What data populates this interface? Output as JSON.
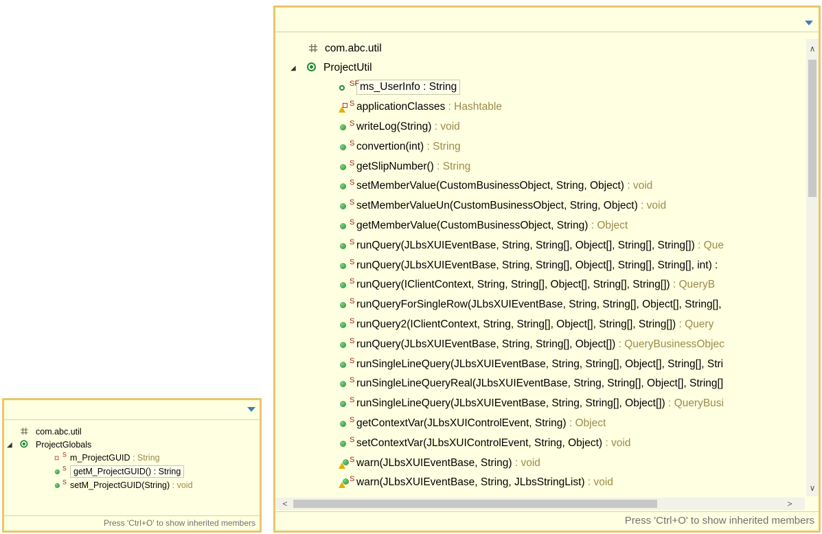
{
  "left_popup": {
    "search_value": "",
    "footer": "Press 'Ctrl+O' to show inherited members",
    "package": "com.abc.util",
    "class_name": "ProjectGlobals",
    "members": [
      {
        "name": "m_ProjectGUID",
        "ret": " : String",
        "modifier": "S",
        "icon": "private-field-icon",
        "ret_muted": true
      },
      {
        "name": "getM_ProjectGUID() : String",
        "ret": "",
        "modifier": "S",
        "icon": "public-method-icon",
        "ret_muted": false,
        "selected": true
      },
      {
        "name": "setM_ProjectGUID(String)",
        "ret": " : void",
        "modifier": "S",
        "icon": "public-method-icon",
        "ret_muted": true
      }
    ]
  },
  "right_popup": {
    "search_value": "",
    "footer": "Press 'Ctrl+O' to show inherited members",
    "package": "com.abc.util",
    "class_name": "ProjectUtil",
    "members": [
      {
        "name": "ms_UserInfo : String",
        "ret": "",
        "modifier": "SF",
        "icon": "final-field-icon",
        "selected": true
      },
      {
        "name": "applicationClasses",
        "ret": " : Hashtable",
        "modifier": "S",
        "icon": "warning-private-field-icon"
      },
      {
        "name": "writeLog(String)",
        "ret": " : void",
        "modifier": "S",
        "icon": "public-method-icon"
      },
      {
        "name": "convertion(int)",
        "ret": " : String",
        "modifier": "S",
        "icon": "public-method-icon"
      },
      {
        "name": "getSlipNumber()",
        "ret": " : String",
        "modifier": "S",
        "icon": "public-method-icon"
      },
      {
        "name": "setMemberValue(CustomBusinessObject, String, Object)",
        "ret": " : void",
        "modifier": "S",
        "icon": "public-method-icon"
      },
      {
        "name": "setMemberValueUn(CustomBusinessObject, String, Object)",
        "ret": " : void",
        "modifier": "S",
        "icon": "public-method-icon"
      },
      {
        "name": "getMemberValue(CustomBusinessObject, String)",
        "ret": " : Object",
        "modifier": "S",
        "icon": "public-method-icon"
      },
      {
        "name": "runQuery(JLbsXUIEventBase, String, String[], Object[], String[], String[])",
        "ret": " : Que",
        "modifier": "S",
        "icon": "public-method-icon"
      },
      {
        "name": "runQuery(JLbsXUIEventBase, String, String[], Object[], String[], String[], int) :",
        "ret": "",
        "modifier": "S",
        "icon": "public-method-icon"
      },
      {
        "name": "runQuery(IClientContext, String, String[], Object[], String[], String[])",
        "ret": " : QueryB",
        "modifier": "S",
        "icon": "public-method-icon"
      },
      {
        "name": "runQueryForSingleRow(JLbsXUIEventBase, String, String[], Object[], String[],",
        "ret": "",
        "modifier": "S",
        "icon": "public-method-icon"
      },
      {
        "name": "runQuery2(IClientContext, String, String[], Object[], String[], String[])",
        "ret": " : Query",
        "modifier": "S",
        "icon": "public-method-icon"
      },
      {
        "name": "runQuery(JLbsXUIEventBase, String, String[], Object[])",
        "ret": " : QueryBusinessObjec",
        "modifier": "S",
        "icon": "public-method-icon"
      },
      {
        "name": "runSingleLineQuery(JLbsXUIEventBase, String, String[], Object[], String[], Stri",
        "ret": "",
        "modifier": "S",
        "icon": "public-method-icon"
      },
      {
        "name": "runSingleLineQueryReal(JLbsXUIEventBase, String, String[], Object[], String[]",
        "ret": "",
        "modifier": "S",
        "icon": "public-method-icon"
      },
      {
        "name": "runSingleLineQuery(JLbsXUIEventBase, String, String[], Object[])",
        "ret": " : QueryBusi",
        "modifier": "S",
        "icon": "public-method-icon"
      },
      {
        "name": "getContextVar(JLbsXUIControlEvent, String)",
        "ret": " : Object",
        "modifier": "S",
        "icon": "public-method-icon"
      },
      {
        "name": "setContextVar(JLbsXUIControlEvent, String, Object)",
        "ret": " : void",
        "modifier": "S",
        "icon": "public-method-icon"
      },
      {
        "name": "warn(JLbsXUIEventBase, String)",
        "ret": " : void",
        "modifier": "S",
        "icon": "warning-method-icon"
      },
      {
        "name": "warn(JLbsXUIEventBase, String, JLbsStringList)",
        "ret": " : void",
        "modifier": "S",
        "icon": "warning-method-icon"
      }
    ]
  },
  "colors": {
    "popup_bg": "#ffffe1",
    "border": "#e8c66a",
    "return_type": "#9b8b4a",
    "method_green": "#1f8a3a",
    "modifier_red": "#a0201e"
  }
}
